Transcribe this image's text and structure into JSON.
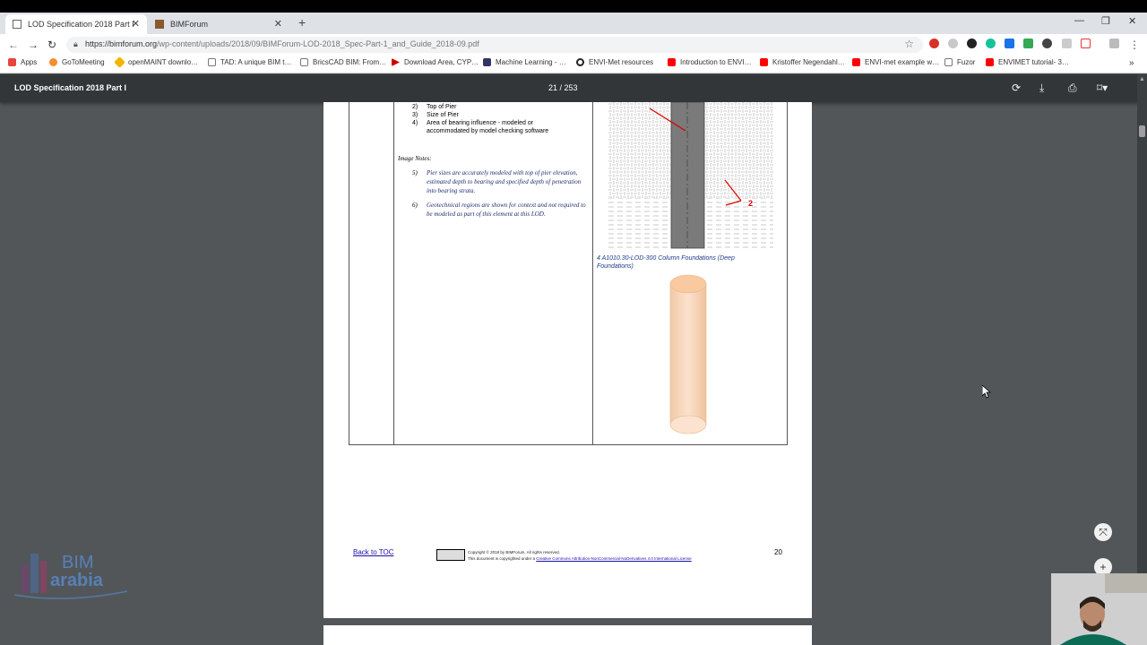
{
  "browser": {
    "tabs": [
      {
        "label": "LOD Specification 2018 Part I",
        "active": true
      },
      {
        "label": "BIMForum",
        "active": false
      }
    ],
    "url_prefix": "https://bimforum.org",
    "url_rest": "/wp-content/uploads/2018/09/BIMForum-LOD-2018_Spec-Part-1_and_Guide_2018-09.pdf"
  },
  "bookmarks": [
    {
      "label": "Apps",
      "icon": "apps-grid-icon",
      "color": "#e8453c"
    },
    {
      "label": "GoToMeeting",
      "icon": "gotomeeting-icon",
      "color": "#f68d2e"
    },
    {
      "label": "openMAINT downlo…",
      "icon": "openmaint-icon",
      "color": "#f4b400"
    },
    {
      "label": "TAD: A unique BIM t…",
      "icon": "page-icon",
      "color": "#cccccc"
    },
    {
      "label": "BricsCAD BIM: From…",
      "icon": "page-icon",
      "color": "#cccccc"
    },
    {
      "label": "Download Area, CYP…",
      "icon": "cype-icon",
      "color": "#cc0000"
    },
    {
      "label": "Machine Learning - …",
      "icon": "ml-icon",
      "color": "#333366"
    },
    {
      "label": "ENVI-Met resources",
      "icon": "envimet-icon",
      "color": "#222222"
    },
    {
      "label": "Introduction to ENVI…",
      "icon": "youtube-icon",
      "color": "#ff0000"
    },
    {
      "label": "Kristoffer Negendahl…",
      "icon": "youtube-icon",
      "color": "#ff0000"
    },
    {
      "label": "ENVI-met example w…",
      "icon": "youtube-icon",
      "color": "#ff0000"
    },
    {
      "label": "Fuzor",
      "icon": "page-icon",
      "color": "#cccccc"
    },
    {
      "label": "ENVIMET tutorial- 3…",
      "icon": "youtube-icon",
      "color": "#ff0000"
    }
  ],
  "pdf": {
    "title": "LOD Specification 2018 Part I",
    "page_current": "21",
    "page_total": "253",
    "page_indicator": "21 / 253"
  },
  "content": {
    "list_items": [
      {
        "num": "2)",
        "text": "Top of Pier"
      },
      {
        "num": "3)",
        "text": "Size of Pier"
      },
      {
        "num": "4)",
        "text": "Area of bearing influence - modeled or"
      },
      {
        "num": "",
        "text": "accommodated by model checking software"
      }
    ],
    "image_notes_heading": "Image Notes:",
    "notes": [
      {
        "num": "5)",
        "text": "Pier sizes are accurately modeled with top of pier elevation, estimated depth to bearing and specified depth of penetration into bearing strata."
      },
      {
        "num": "6)",
        "text": "Geotechnical regions are shown for context and not required to be modeled as part of this element at this LOD."
      }
    ],
    "drawing_callout": "2",
    "caption_line1": "4 A1010.30-LOD-300 Column Foundations (Deep",
    "caption_line2": "Foundations)"
  },
  "footer": {
    "back_to_toc": "Back to TOC",
    "copyright_line1": "Copyright © 2018 by BIMForum. All rights reserved.",
    "copyright_line2_prefix": "This document is copyrighted under a ",
    "copyright_link": "Creative Commons Attribution-NonCommercial-NoDerivatives 4.0 International License",
    "page_number": "20"
  },
  "watermark": {
    "brand_top": "BIM",
    "brand_bottom": "arabia"
  },
  "colors": {
    "pdf_toolbar": "#323639",
    "viewer_bg": "#525659",
    "pier_fill": "#f7d9bd",
    "pier_top": "#f9c9a0",
    "callout_red": "#dd0000",
    "note_blue": "#1f2d6d"
  }
}
